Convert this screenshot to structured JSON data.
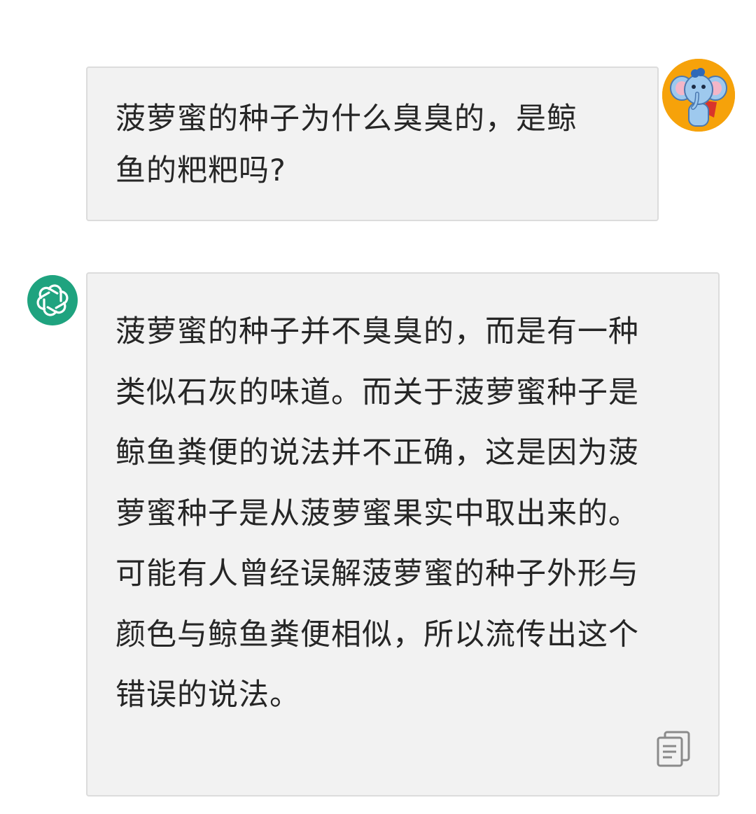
{
  "chat": {
    "user_message": {
      "avatar_icon": "elephant-avatar-icon",
      "text": "菠萝蜜的种子为什么臭臭的，是鲸\n鱼的粑粑吗?"
    },
    "assistant_message": {
      "avatar_icon": "openai-logo-icon",
      "text": "菠萝蜜的种子并不臭臭的，而是有一种\n类似石灰的味道。而关于菠萝蜜种子是\n鲸鱼粪便的说法并不正确，这是因为菠\n萝蜜种子是从菠萝蜜果实中取出来的。\n可能有人曾经误解菠萝蜜的种子外形与\n颜色与鲸鱼粪便相似，所以流传出这个\n错误的说法。",
      "copy_icon": "copy-icon"
    }
  },
  "colors": {
    "bubble_background": "#f2f2f2",
    "bubble_border": "#dcdcdc",
    "assistant_avatar": "#1fa37f",
    "user_avatar": "#f6a20a",
    "text": "#262626"
  }
}
